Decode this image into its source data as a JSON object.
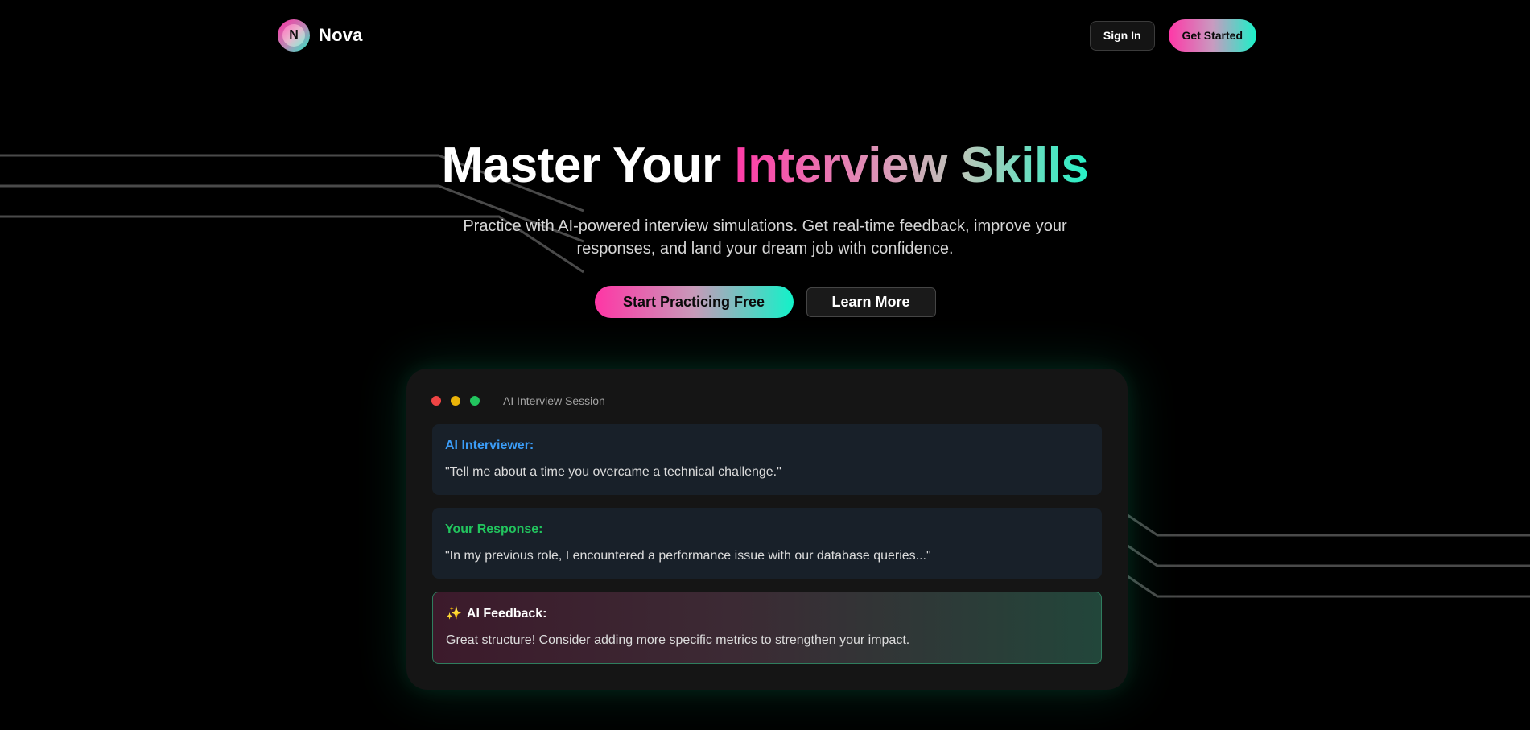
{
  "nav": {
    "logo_letter": "N",
    "brand": "Nova",
    "sign_in": "Sign In",
    "get_started": "Get Started"
  },
  "hero": {
    "title_plain": "Master Your ",
    "title_highlight": "Interview Skills",
    "subtitle": "Practice with AI-powered interview simulations. Get real-time feedback, improve your responses, and land your dream job with confidence.",
    "primary_cta": "Start Practicing Free",
    "secondary_cta": "Learn More"
  },
  "demo": {
    "window_title": "AI Interview Session",
    "messages": [
      {
        "label": "AI Interviewer:",
        "text": "\"Tell me about a time you overcame a technical challenge.\""
      },
      {
        "label": "Your Response:",
        "text": "\"In my previous role, I encountered a performance issue with our database queries...\""
      },
      {
        "icon": "sparkles-icon",
        "label": "AI Feedback:",
        "text": "Great structure! Consider adding more specific metrics to strengthen your impact."
      }
    ]
  },
  "colors": {
    "accent_pink": "#ff35a5",
    "accent_teal": "#12f2c9",
    "interviewer_label": "#3b9cf6",
    "response_label": "#22c55e"
  }
}
